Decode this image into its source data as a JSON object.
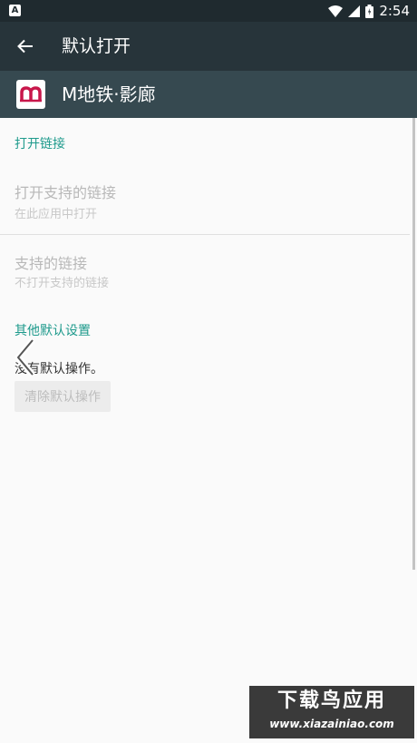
{
  "status_bar": {
    "left_icon": "A",
    "time": "2:54",
    "icons": [
      "wifi-icon",
      "signal-icon",
      "battery-icon"
    ]
  },
  "toolbar": {
    "title": "默认打开",
    "back_icon": "arrow-left-icon"
  },
  "app": {
    "name": "M地铁·影廊",
    "brand_color": "#c8174b"
  },
  "sections": {
    "open_links": {
      "header": "打开链接",
      "open_supported": {
        "title": "打开支持的链接",
        "summary": "在此应用中打开"
      },
      "supported_links": {
        "title": "支持的链接",
        "summary": "不打开支持的链接"
      }
    },
    "other_defaults": {
      "header": "其他默认设置",
      "no_defaults_text": "没有默认操作。",
      "clear_button": "清除默认操作"
    }
  },
  "watermark": {
    "title": "下载鸟应用",
    "url": "www.xiazainiao.com"
  },
  "colors": {
    "accent": "#1e9a8c",
    "toolbar": "#27343a",
    "app_header": "#364950",
    "status_bar": "#1f2a2f"
  }
}
